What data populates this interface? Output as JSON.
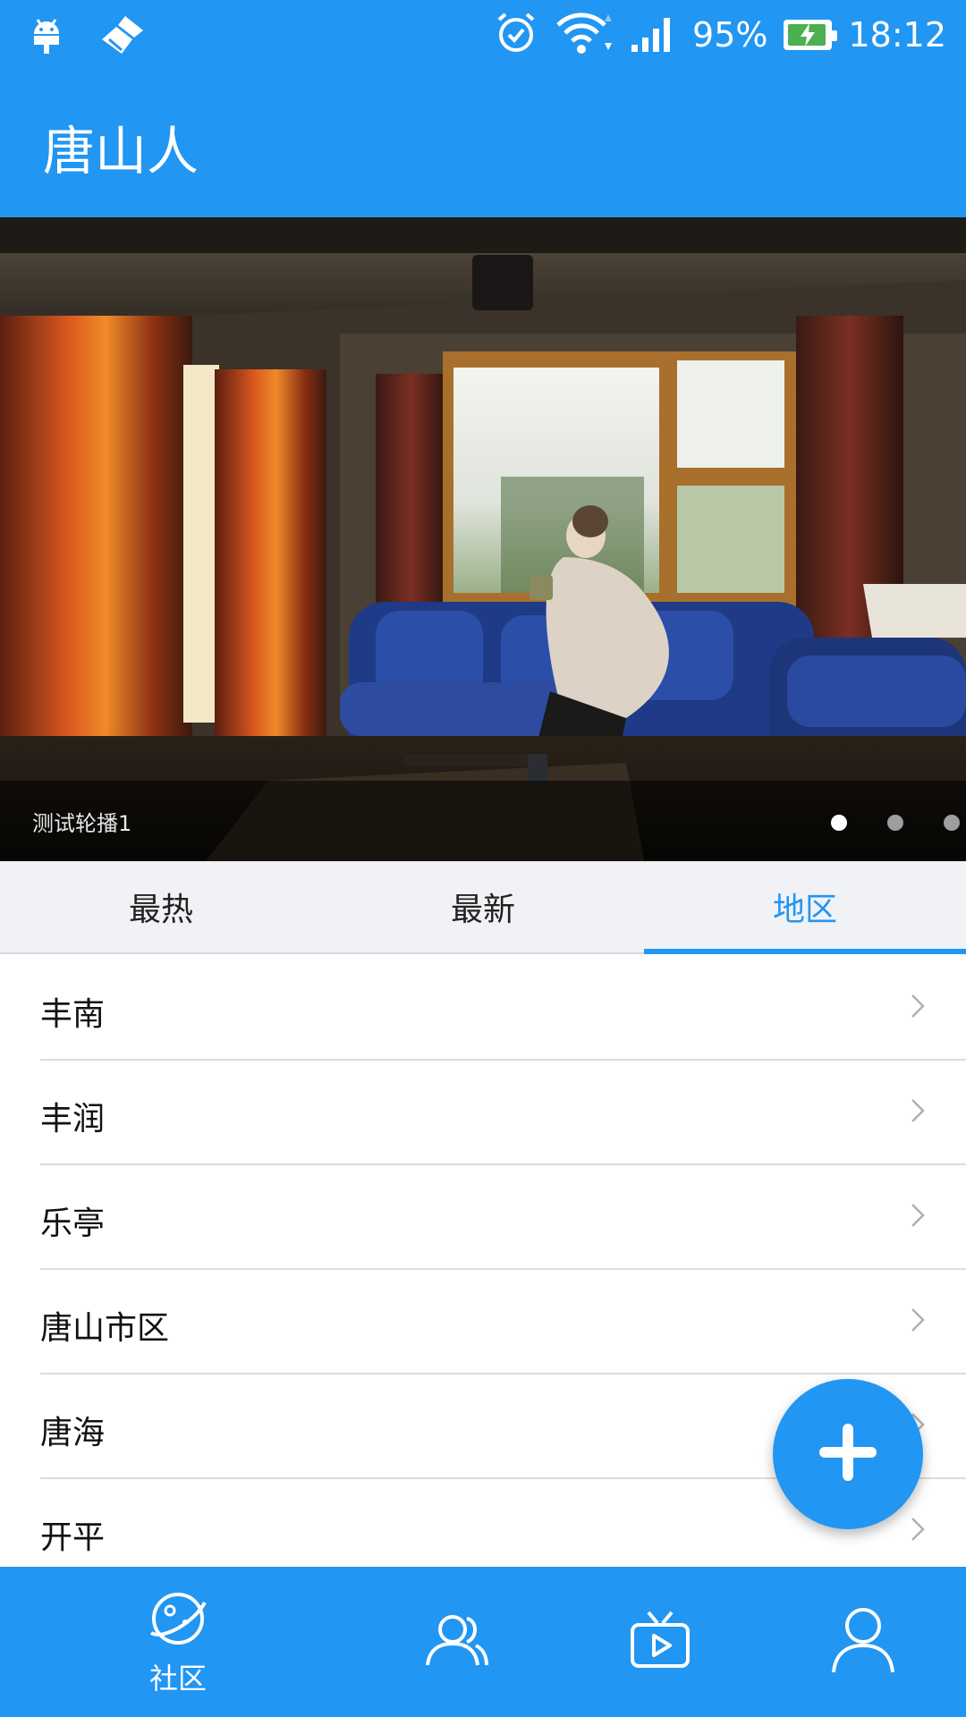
{
  "status_bar": {
    "battery_percent": "95%",
    "battery_level": 0.95,
    "time": "18:12",
    "icons": [
      "android-debug-icon",
      "cleaner-icon",
      "alarm-icon",
      "wifi-icon",
      "signal-icon",
      "battery-charging-icon"
    ]
  },
  "app_bar": {
    "title": "唐山人"
  },
  "carousel": {
    "caption": "测试轮播1",
    "slide_count": 3,
    "active_index": 0
  },
  "tabs": [
    {
      "label": "最热",
      "active": false
    },
    {
      "label": "最新",
      "active": false
    },
    {
      "label": "地区",
      "active": true
    }
  ],
  "regions": [
    {
      "label": "丰南"
    },
    {
      "label": "丰润"
    },
    {
      "label": "乐亭"
    },
    {
      "label": "唐山市区"
    },
    {
      "label": "唐海"
    },
    {
      "label": "开平"
    }
  ],
  "fab": {
    "icon": "plus-icon"
  },
  "bottom_nav": [
    {
      "icon": "planet-icon",
      "label": "社区",
      "active": true
    },
    {
      "icon": "friends-icon",
      "label": "",
      "active": false
    },
    {
      "icon": "tv-play-icon",
      "label": "",
      "active": false
    },
    {
      "icon": "profile-icon",
      "label": "",
      "active": false
    }
  ],
  "colors": {
    "primary": "#2196F3",
    "tab_bar_bg": "#F0F2F5",
    "battery_fill": "#4CAF50"
  }
}
